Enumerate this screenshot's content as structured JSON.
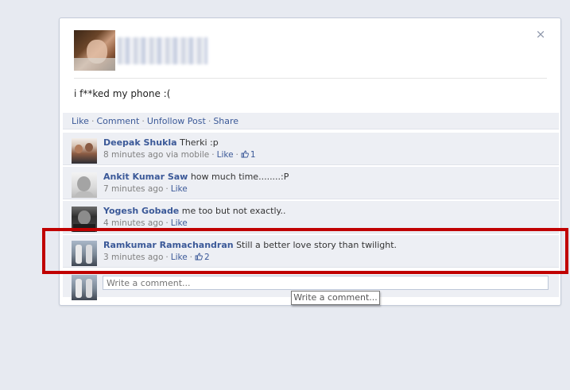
{
  "post": {
    "status_text": "i f**ked my phone :(",
    "close_glyph": "×"
  },
  "actions": {
    "like": "Like",
    "comment": "Comment",
    "unfollow": "Unfollow Post",
    "share": "Share",
    "separator": "·"
  },
  "comments": [
    {
      "author": "Deepak Shukla",
      "text": "Therki :p",
      "time": "8 minutes ago",
      "via": "via mobile",
      "like": "Like",
      "likes": "1"
    },
    {
      "author": "Ankit Kumar Saw",
      "text": "how much time........:P",
      "time": "7 minutes ago",
      "like": "Like"
    },
    {
      "author": "Yogesh Gobade",
      "text": "me too but not exactly..",
      "time": "4 minutes ago",
      "like": "Like"
    },
    {
      "author": "Ramkumar Ramachandran",
      "text": "Still a better love story than twilight.",
      "time": "3 minutes ago",
      "like": "Like",
      "likes": "2"
    }
  ],
  "compose": {
    "placeholder": "Write a comment...",
    "tooltip": "Write a comment..."
  },
  "colors": {
    "link": "#3b5998",
    "highlight": "#c00000",
    "background": "#e7eaf1"
  }
}
